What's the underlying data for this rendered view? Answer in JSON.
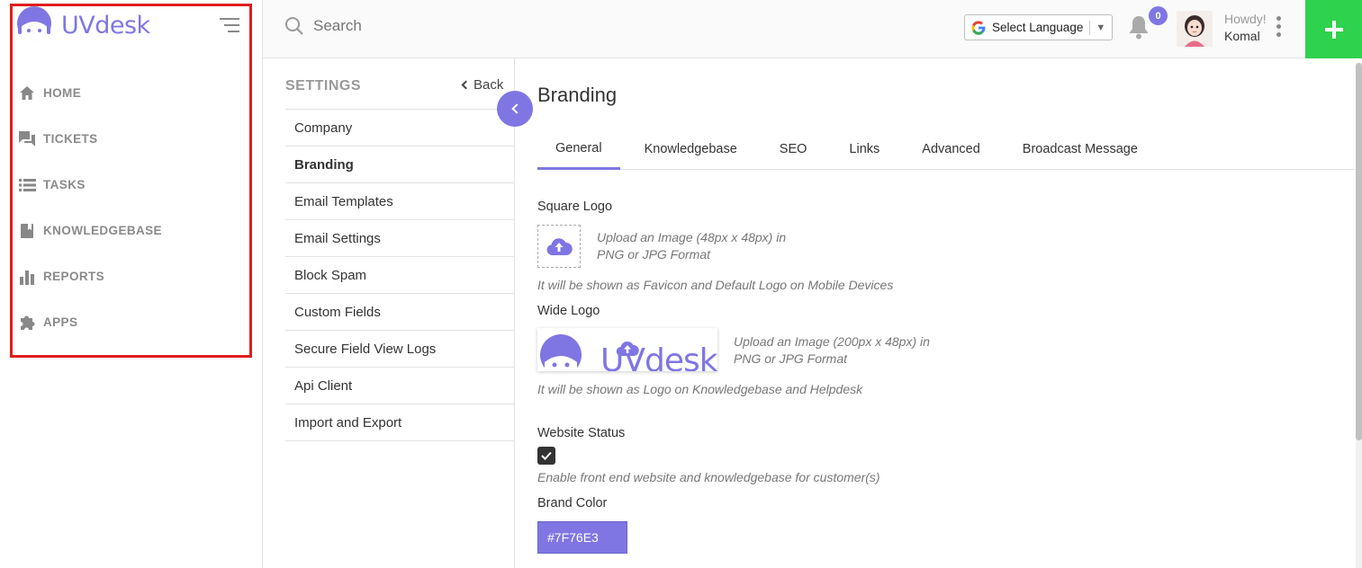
{
  "app": {
    "brand": "UVdesk",
    "brand_color": "#7f76e3"
  },
  "sidebar": {
    "items": [
      {
        "label": "HOME",
        "icon": "home-icon"
      },
      {
        "label": "TICKETS",
        "icon": "tickets-icon"
      },
      {
        "label": "TASKS",
        "icon": "tasks-icon"
      },
      {
        "label": "KNOWLEDGEBASE",
        "icon": "book-icon"
      },
      {
        "label": "REPORTS",
        "icon": "bar-chart-icon"
      },
      {
        "label": "APPS",
        "icon": "puzzle-icon"
      }
    ]
  },
  "topbar": {
    "search_placeholder": "Search",
    "language_label": "Select Language",
    "notification_count": "0",
    "greeting": "Howdy!",
    "user_name": "Komal",
    "add_button_color": "#2ed24d"
  },
  "settings": {
    "title": "SETTINGS",
    "back_label": "Back",
    "items": [
      {
        "label": "Company",
        "active": false
      },
      {
        "label": "Branding",
        "active": true
      },
      {
        "label": "Email Templates",
        "active": false
      },
      {
        "label": "Email Settings",
        "active": false
      },
      {
        "label": "Block Spam",
        "active": false
      },
      {
        "label": "Custom Fields",
        "active": false
      },
      {
        "label": "Secure Field View Logs",
        "active": false
      },
      {
        "label": "Api Client",
        "active": false
      },
      {
        "label": "Import and Export",
        "active": false
      }
    ]
  },
  "main": {
    "title": "Branding",
    "tabs": [
      {
        "label": "General",
        "active": true
      },
      {
        "label": "Knowledgebase",
        "active": false
      },
      {
        "label": "SEO",
        "active": false
      },
      {
        "label": "Links",
        "active": false
      },
      {
        "label": "Advanced",
        "active": false
      },
      {
        "label": "Broadcast Message",
        "active": false
      }
    ],
    "square_logo": {
      "label": "Square Logo",
      "upload_hint_1": "Upload an Image (48px x 48px) in",
      "upload_hint_2": "PNG or JPG Format",
      "note": "It will be shown as Favicon and Default Logo on Mobile Devices"
    },
    "wide_logo": {
      "label": "Wide Logo",
      "preview_text": "UVdesk",
      "upload_hint_1": "Upload an Image (200px x 48px) in",
      "upload_hint_2": "PNG or JPG Format",
      "note": "It will be shown as Logo on Knowledgebase and Helpdesk"
    },
    "website_status": {
      "label": "Website Status",
      "checked": true,
      "note": "Enable front end website and knowledgebase for customer(s)"
    },
    "brand_color": {
      "label": "Brand Color",
      "value": "#7F76E3"
    }
  }
}
